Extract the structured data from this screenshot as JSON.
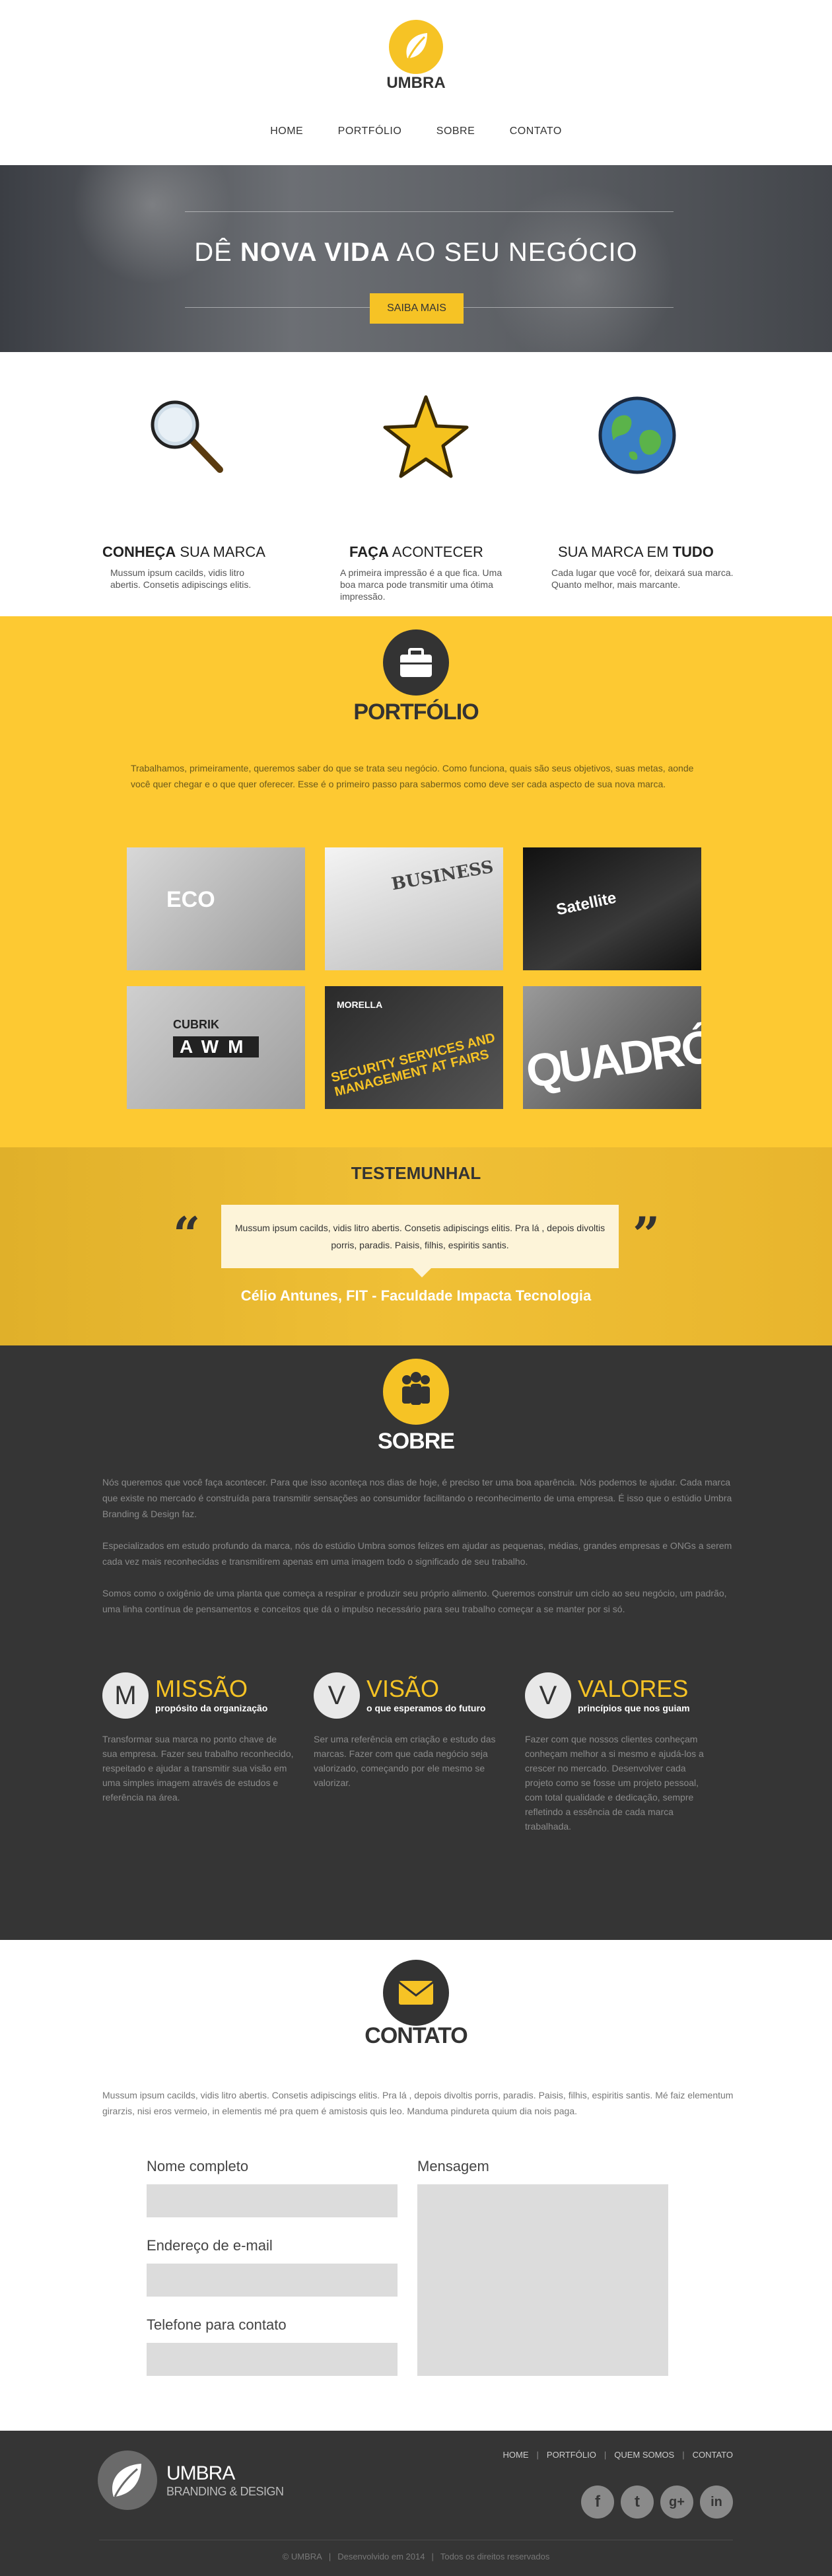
{
  "header": {
    "logo_text": "UMBRA",
    "nav": [
      "HOME",
      "PORTFÓLIO",
      "SOBRE",
      "CONTATO"
    ]
  },
  "hero": {
    "title_pre": "DÊ ",
    "title_bold": "NOVA VIDA",
    "title_post": " AO SEU NEGÓCIO",
    "button": "SAIBA MAIS"
  },
  "features": [
    {
      "icon": "magnifier-icon",
      "title_bold": "CONHEÇA",
      "title_rest": " SUA MARCA",
      "text": "Mussum ipsum cacilds, vidis litro abertis. Consetis adipiscings elitis."
    },
    {
      "icon": "star-icon",
      "title_bold": "FAÇA",
      "title_rest": " ACONTECER",
      "text": "A primeira impressão é a que fica. Uma boa marca pode transmitir uma ótima impressão."
    },
    {
      "icon": "globe-icon",
      "title_pre": "SUA MARCA EM ",
      "title_bold": "TUDO",
      "text": "Cada lugar que você for, deixará sua marca. Quanto melhor, mais marcante."
    }
  ],
  "portfolio": {
    "title": "PORTFÓLIO",
    "text": "Trabalhamos, primeiramente, queremos saber do que se trata seu negócio. Como funciona, quais são seus objetivos, suas metas, aonde você quer chegar e o que quer oferecer. Esse é o primeiro passo para sabermos como deve ser cada aspecto de sua nova marca.",
    "thumbs": [
      {
        "label": "ECO"
      },
      {
        "label": "BUSINESS"
      },
      {
        "label": "Satellite"
      },
      {
        "label": "CUBRIK",
        "sub": "AWM"
      },
      {
        "label": "MORELLA",
        "sub": "SECURITY SERVICES AND MANAGEMENT AT FAIRS"
      },
      {
        "label": "QUADRÓ"
      }
    ]
  },
  "testimonial": {
    "title": "TESTEMUNHAL",
    "quote": "Mussum ipsum cacilds, vidis litro abertis. Consetis adipiscings elitis. Pra lá , depois divoltis porris, paradis. Paisis, filhis, espiritis santis.",
    "author": "Célio Antunes, FIT - Faculdade Impacta Tecnologia",
    "quote_open": "“",
    "quote_close": "”"
  },
  "sobre": {
    "title": "SOBRE",
    "paragraphs": [
      "Nós queremos que você faça acontecer. Para que isso aconteça nos dias de hoje, é preciso ter uma boa aparência. Nós podemos te ajudar. Cada marca que existe no mercado é construída para transmitir sensações ao consumidor facilitando o reconhecimento de uma empresa. É isso que o estúdio Umbra Branding & Design faz.",
      "Especializados em estudo profundo da marca, nós do estúdio Umbra somos felizes em ajudar as pequenas, médias, grandes empresas e ONGs a serem cada vez mais reconhecidas e transmitirem apenas em uma imagem todo o significado de seu trabalho.",
      "Somos como o oxigênio de uma planta que começa a respirar e produzir seu próprio alimento. Queremos construir um ciclo ao seu negócio, um padrão, uma linha contínua de pensamentos e conceitos que dá o impulso necessário para seu trabalho começar a se manter por si só."
    ],
    "values": [
      {
        "letter": "M",
        "title": "MISSÃO",
        "sub": "propósito da organização",
        "text": "Transformar sua marca no ponto chave de sua empresa. Fazer seu trabalho reconhecido, respeitado e ajudar a transmitir sua visão em uma simples imagem através de estudos e referência na área."
      },
      {
        "letter": "V",
        "title": "VISÃO",
        "sub": "o que esperamos do futuro",
        "text": "Ser uma referência em criação e estudo das marcas. Fazer com que cada negócio seja valorizado, começando por ele mesmo se valorizar."
      },
      {
        "letter": "V",
        "title": "VALORES",
        "sub": "princípios que nos guiam",
        "text": "Fazer com que nossos clientes conheçam conheçam melhor a si mesmo e ajudá-los  a crescer no mercado. Desenvolver cada projeto como se fosse um projeto pessoal, com total qualidade e dedicação, sempre refletindo a essência de cada marca trabalhada."
      }
    ]
  },
  "contato": {
    "title": "CONTATO",
    "text": "Mussum ipsum cacilds, vidis litro abertis. Consetis adipiscings elitis. Pra lá , depois divoltis porris, paradis. Paisis, filhis, espiritis santis. Mé faiz elementum girarzis, nisi eros vermeio, in elementis mé pra quem é amistosis quis leo. Manduma pindureta quium dia nois paga.",
    "fields": {
      "name": "Nome completo",
      "email": "Endereço de e-mail",
      "phone": "Telefone para contato",
      "message": "Mensagem"
    }
  },
  "footer": {
    "brand": "UMBRA",
    "tagline": "BRANDING & DESIGN",
    "nav": [
      "HOME",
      "PORTFÓLIO",
      "QUEM SOMOS",
      "CONTATO"
    ],
    "social": [
      "f",
      "t",
      "g+",
      "in"
    ],
    "copy": [
      "© UMBRA",
      "Desenvolvido em 2014",
      "Todos os direitos reservados"
    ]
  }
}
